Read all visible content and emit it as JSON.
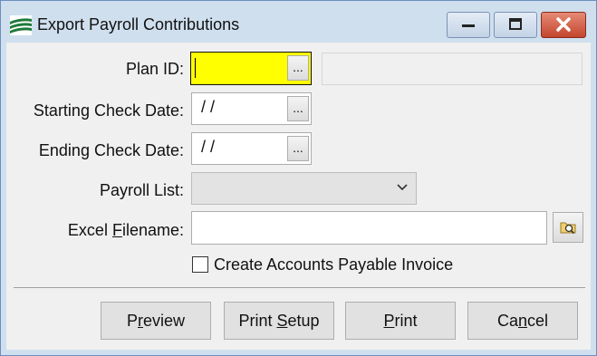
{
  "window": {
    "title": "Export Payroll Contributions"
  },
  "form": {
    "plan_id": {
      "label": "Plan ID:",
      "value": "",
      "ellipsis": "..."
    },
    "plan_desc": {
      "value": ""
    },
    "start_date": {
      "label": "Starting Check Date:",
      "value": "/  /",
      "ellipsis": "..."
    },
    "end_date": {
      "label": "Ending Check Date:",
      "value": "/  /",
      "ellipsis": "..."
    },
    "payroll_list": {
      "label": "Payroll List:",
      "value": ""
    },
    "excel": {
      "label_pre": "Excel ",
      "label_u": "F",
      "label_post": "ilename:",
      "value": ""
    },
    "create_ap": {
      "label": "Create Accounts Payable Invoice",
      "checked": false
    }
  },
  "buttons": {
    "preview": {
      "pre": "P",
      "u": "r",
      "post": "eview"
    },
    "print_setup": {
      "pre": "Print ",
      "u": "S",
      "post": "etup"
    },
    "print": {
      "pre": "",
      "u": "P",
      "post": "rint"
    },
    "cancel": {
      "pre": "Ca",
      "u": "n",
      "post": "cel"
    }
  },
  "icons": {
    "app": "app-logo-icon",
    "minimize": "minimize-icon",
    "maximize": "maximize-icon",
    "close": "close-icon",
    "dropdown": "chevron-down-icon",
    "browse": "folder-search-icon"
  }
}
